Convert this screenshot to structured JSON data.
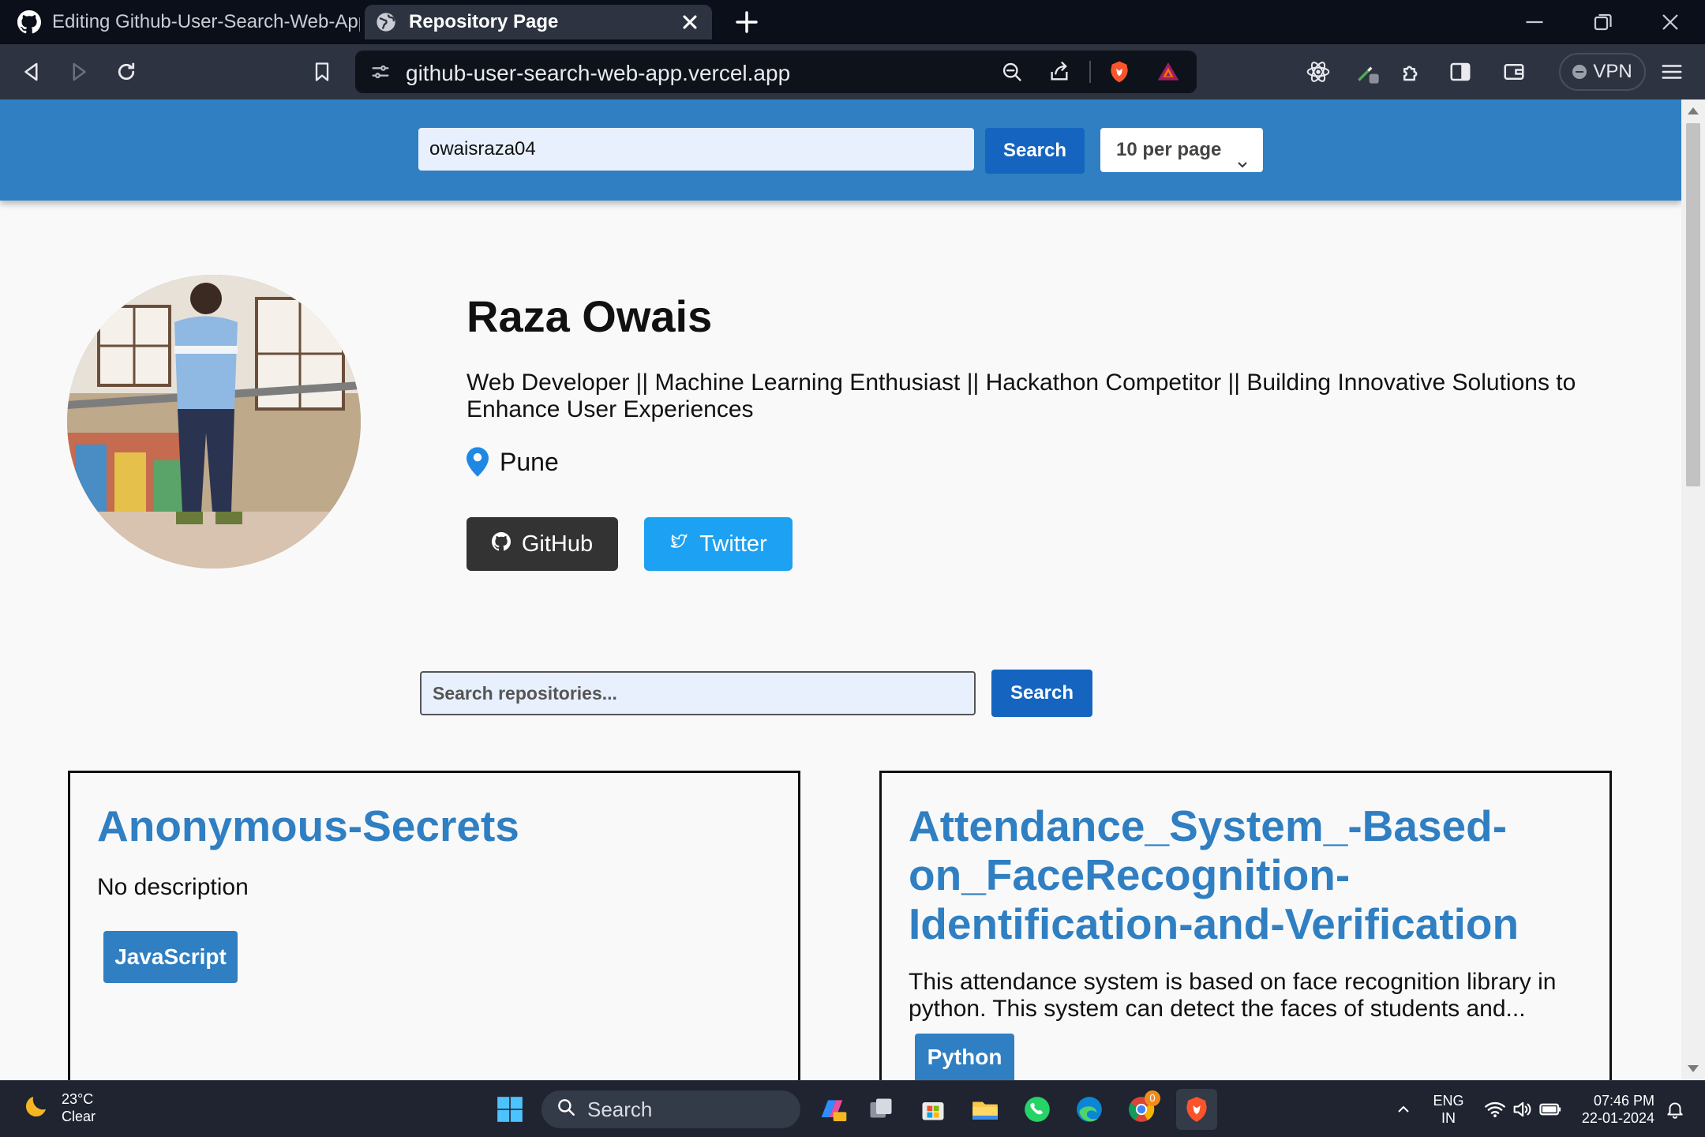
{
  "browser": {
    "tabs": [
      {
        "title": "Editing Github-User-Search-Web-App/",
        "active": false
      },
      {
        "title": "Repository Page",
        "active": true
      }
    ],
    "url": "github-user-search-web-app.vercel.app",
    "vpn_label": "VPN"
  },
  "header": {
    "username_value": "owaisraza04",
    "search_label": "Search",
    "per_page_selected": "10 per page"
  },
  "profile": {
    "name": "Raza Owais",
    "bio": "Web Developer || Machine Learning Enthusiast || Hackathon Competitor || Building Innovative Solutions to Enhance User Experiences",
    "location": "Pune",
    "github_label": "GitHub",
    "twitter_label": "Twitter"
  },
  "repo_search": {
    "placeholder": "Search repositories...",
    "button_label": "Search"
  },
  "repos": [
    {
      "name": "Anonymous-Secrets",
      "description": "No description",
      "language": "JavaScript"
    },
    {
      "name": "Attendance_System_-Based-on_FaceRecognition-Identification-and-Verification",
      "description": "This attendance system is based on face recognition library in python. This system can detect the faces of students and...",
      "language": "Python"
    }
  ],
  "taskbar": {
    "weather_temp": "23°C",
    "weather_cond": "Clear",
    "search_label": "Search",
    "lang_line1": "ENG",
    "lang_line2": "IN",
    "time": "07:46 PM",
    "date": "22-01-2024",
    "chrome_badge": "0"
  },
  "colors": {
    "header": "#2f7fc2",
    "primary_button": "#1565c0",
    "link_blue": "#2f7fc2",
    "github_button": "#333333",
    "twitter_button": "#1da1f2"
  }
}
